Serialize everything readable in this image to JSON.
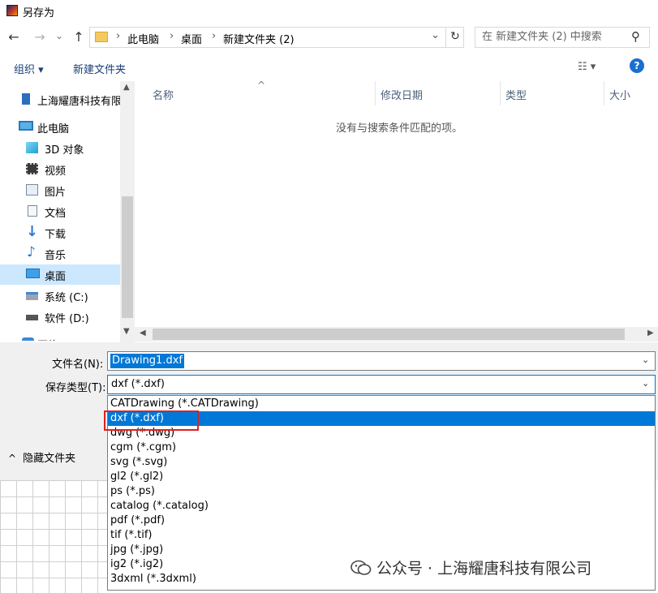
{
  "window": {
    "title": "另存为"
  },
  "nav": {
    "back_icon": "←",
    "forward_icon": "→",
    "recent_icon": "⌄",
    "up_icon": "↑",
    "breadcrumbs": [
      "此电脑",
      "桌面",
      "新建文件夹 (2)"
    ],
    "crumb_sep": "›",
    "addr_dropdown_icon": "⌄",
    "refresh_icon": "↻",
    "search_placeholder": "在 新建文件夹 (2) 中搜索",
    "search_icon": "⚲"
  },
  "toolbar": {
    "organize_label": "组织 ▾",
    "new_folder_label": "新建文件夹",
    "view_icon": "☷ ▾",
    "help_icon": "?"
  },
  "sidebar": {
    "items": [
      {
        "label": "上海耀唐科技有限",
        "icon": "building-icon"
      },
      {
        "label": "此电脑",
        "icon": "computer-icon"
      },
      {
        "label": "3D 对象",
        "icon": "cube-icon"
      },
      {
        "label": "视频",
        "icon": "video-icon"
      },
      {
        "label": "图片",
        "icon": "picture-icon"
      },
      {
        "label": "文档",
        "icon": "document-icon"
      },
      {
        "label": "下载",
        "icon": "download-icon"
      },
      {
        "label": "音乐",
        "icon": "music-icon"
      },
      {
        "label": "桌面",
        "icon": "desktop-icon",
        "selected": true
      },
      {
        "label": "系统 (C:)",
        "icon": "drive-c-icon"
      },
      {
        "label": "软件 (D:)",
        "icon": "drive-d-icon"
      },
      {
        "label": "网络",
        "icon": "network-icon"
      }
    ]
  },
  "filelist": {
    "sort_icon": "^",
    "columns": [
      "名称",
      "修改日期",
      "类型",
      "大小"
    ],
    "empty_message": "没有与搜索条件匹配的项。"
  },
  "form": {
    "filename_label": "文件名(N):",
    "filename_value": "Drawing1.dxf",
    "type_label": "保存类型(T):",
    "type_value": "dxf (*.dxf)",
    "dropdown_icon": "⌄",
    "hide_folders_label": "隐藏文件夹",
    "hide_folders_icon": "^"
  },
  "file_types": [
    "CATDrawing (*.CATDrawing)",
    "dxf (*.dxf)",
    "dwg (*.dwg)",
    "cgm (*.cgm)",
    "svg (*.svg)",
    "gl2 (*.gl2)",
    "ps (*.ps)",
    "catalog (*.catalog)",
    "pdf (*.pdf)",
    "tif (*.tif)",
    "jpg (*.jpg)",
    "ig2 (*.ig2)",
    "3dxml (*.3dxml)"
  ],
  "selected_file_type_index": 1,
  "watermark": {
    "text": "公众号 · 上海耀唐科技有限公司"
  },
  "colors": {
    "accent": "#0078d7",
    "selection_bg": "#cce8ff",
    "highlight_box": "#e02020"
  }
}
